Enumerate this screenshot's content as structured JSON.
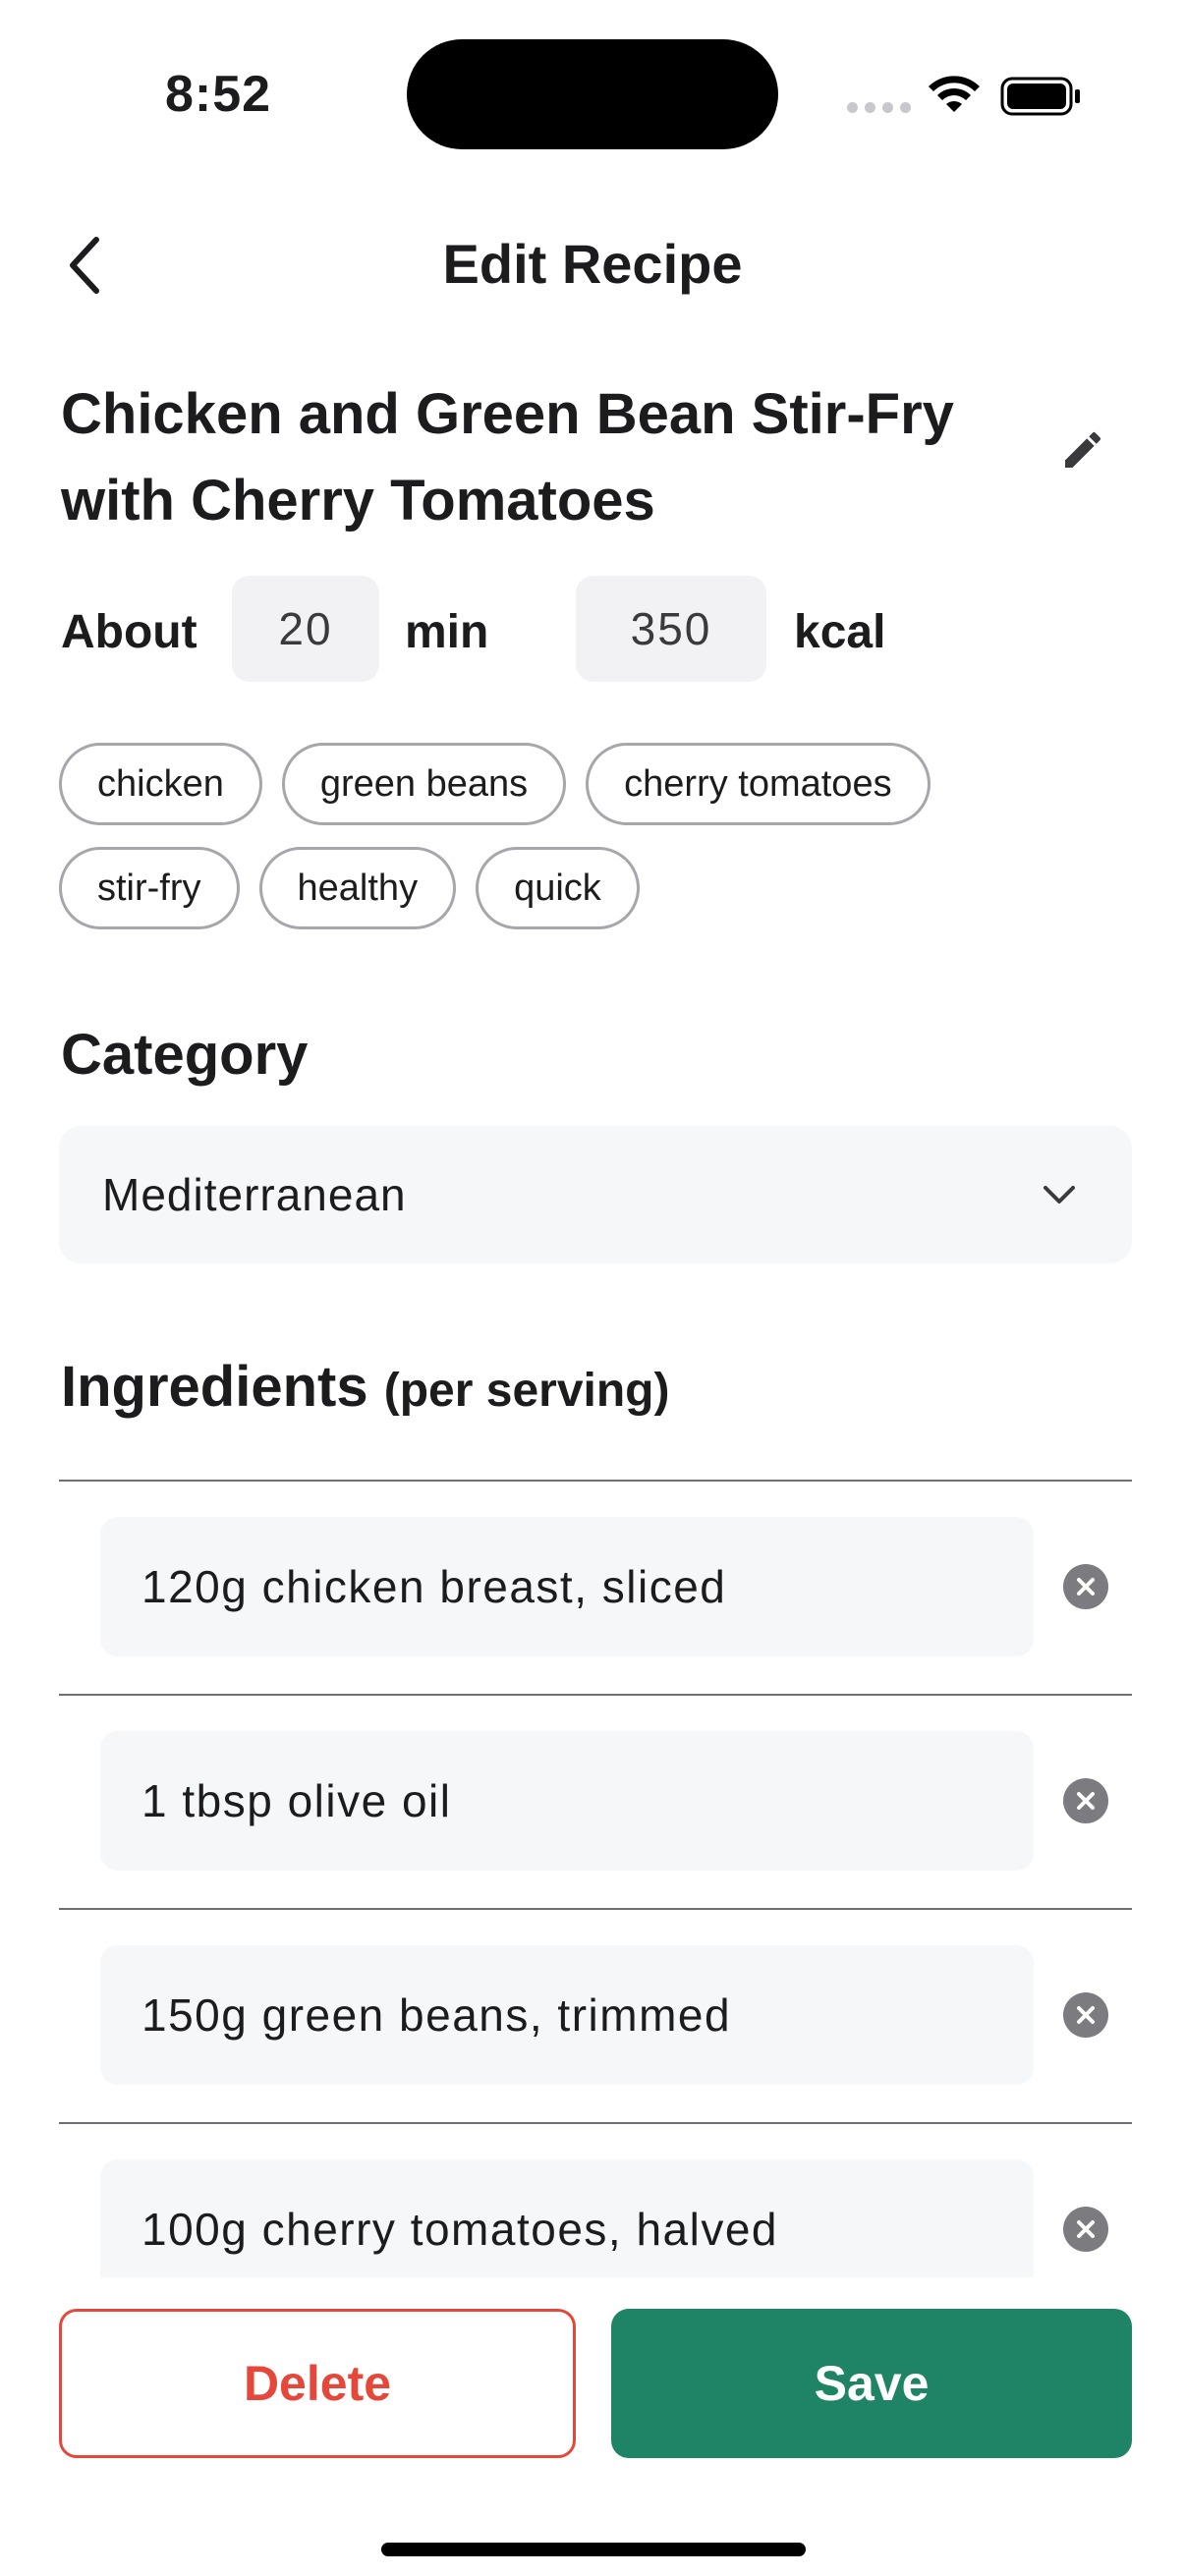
{
  "status_bar": {
    "time": "8:52"
  },
  "header": {
    "title": "Edit Recipe"
  },
  "recipe": {
    "title": "Chicken and Green Bean Stir-Fry with Cherry Tomatoes",
    "about_label": "About",
    "minutes": "20",
    "minutes_unit": "min",
    "calories": "350",
    "calories_unit": "kcal",
    "tags": [
      "chicken",
      "green beans",
      "cherry tomatoes",
      "stir-fry",
      "healthy",
      "quick"
    ]
  },
  "category": {
    "title": "Category",
    "selected": "Mediterranean"
  },
  "ingredients": {
    "title": "Ingredients",
    "subtitle": "(per serving)",
    "items": [
      "120g chicken breast, sliced",
      "1 tbsp olive oil",
      "150g green beans, trimmed",
      "100g cherry tomatoes, halved"
    ]
  },
  "actions": {
    "delete_label": "Delete",
    "save_label": "Save"
  },
  "colors": {
    "accent": "#1e8465",
    "danger": "#e5473b",
    "field_bg": "#f6f7f9"
  },
  "icons": {
    "back": "chevron-left-icon",
    "edit": "pencil-icon",
    "dropdown": "chevron-down-icon",
    "remove": "close-circle-icon"
  }
}
